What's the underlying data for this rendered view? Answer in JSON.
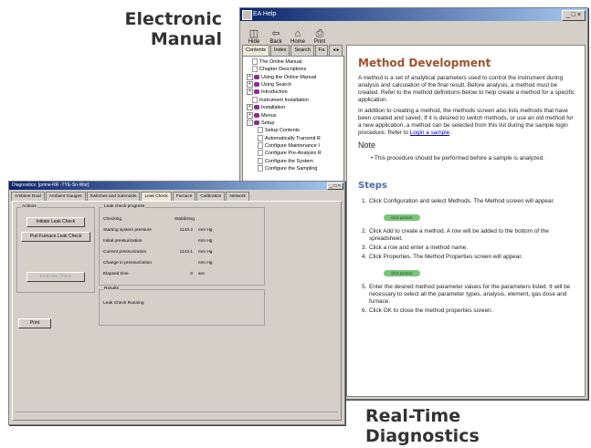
{
  "captions": {
    "manual_line1": "Electronic",
    "manual_line2": "Manual",
    "diag_line1": "Real-Time",
    "diag_line2": "Diagnostics"
  },
  "manual": {
    "title": "EA Help",
    "window_controls": "_ □ ×",
    "toolbar": [
      {
        "label": "Hide",
        "icon": "hide-icon",
        "glyph": "◫"
      },
      {
        "label": "Back",
        "icon": "back-icon",
        "glyph": "⇦"
      },
      {
        "label": "Home",
        "icon": "home-icon",
        "glyph": "⌂"
      },
      {
        "label": "Print",
        "icon": "print-icon",
        "glyph": "⎙"
      }
    ],
    "tabs": [
      "Contents",
      "Index",
      "Search",
      "Fa",
      "◂ ▸"
    ],
    "tree": [
      {
        "label": "The Online Manual",
        "type": "page",
        "indent": 1,
        "expander": ""
      },
      {
        "label": "Chapter Descriptions",
        "type": "page",
        "indent": 1,
        "expander": ""
      },
      {
        "label": "Using the Online Manual",
        "type": "book",
        "indent": 0,
        "expander": "+"
      },
      {
        "label": "Using Search",
        "type": "book",
        "indent": 0,
        "expander": "+"
      },
      {
        "label": "Introduction",
        "type": "book",
        "indent": 0,
        "expander": "+"
      },
      {
        "label": "Instrument Installation",
        "type": "page",
        "indent": 1,
        "expander": ""
      },
      {
        "label": "Installation",
        "type": "book",
        "indent": 0,
        "expander": "+"
      },
      {
        "label": "Menus",
        "type": "book",
        "indent": 0,
        "expander": "+"
      },
      {
        "label": "Setup",
        "type": "book",
        "indent": 0,
        "expander": "-"
      },
      {
        "label": "Setup Contents",
        "type": "page",
        "indent": 2,
        "expander": ""
      },
      {
        "label": "Automatically Transmit R",
        "type": "page",
        "indent": 2,
        "expander": ""
      },
      {
        "label": "Configure Maintenance I",
        "type": "page",
        "indent": 2,
        "expander": ""
      },
      {
        "label": "Configure Pre-Analysis R",
        "type": "page",
        "indent": 2,
        "expander": ""
      },
      {
        "label": "Configure the System",
        "type": "page",
        "indent": 2,
        "expander": ""
      },
      {
        "label": "Configure the Sampling",
        "type": "page",
        "indent": 2,
        "expander": ""
      }
    ],
    "doc": {
      "title": "Method Development",
      "para1": "A method is a set of analytical parameters used to control the instrument during analysis and calculation of the final result. Before analysis, a method must be created. Refer to the method definitions below to help create a method for a specific application.",
      "para2_pre": "In addition to creating a method, the methods screen also lists methods that have been created and saved. If it is desired to switch methods, or use an old method for a new application, a method can be selected from this list during the sample login procedure. Refer to",
      "para2_link": "Login a sample",
      "para2_post": ".",
      "note": "Note",
      "bullet": "This procedure should be performed before a sample is analyzed.",
      "steps_heading": "Steps",
      "step1_num": "1.",
      "step1": "Click Configuration and select Methods. The Method screen will appear.",
      "pill": "click picture",
      "step2_num": "2.",
      "step2": "Click Add to create a method. A row will be added to the bottom of the spreadsheet.",
      "step3_num": "3.",
      "step3": "Click a row and enter a method name.",
      "step4_num": "4.",
      "step4": "Click Properties. The Method Properties screen will appear.",
      "step5_num": "5.",
      "step5": "Enter the desired method parameter values for the parameters listed. It will be necessary to select all the parameter types, analysis, element, gas dose and furnace.",
      "step6_num": "6.",
      "step6": "Click OK to close the method properties screen."
    }
  },
  "diag": {
    "title": "Diagnostics: [prime-RR -TYE-Sn-Wor]",
    "window_controls": "_ □ ×",
    "tabs": [
      "Ambient Dual",
      "Ambient Gauges",
      "Switches and Solenoids",
      "Leak Check",
      "Furnace",
      "Calibration",
      "Network"
    ],
    "active_tab": 3,
    "actions_label": "Actions",
    "btn_initiate": "Initiate Leak Check",
    "btn_furnace": "Purl Furnace Leak Check",
    "btn_evaluate": "Evaluate Check",
    "btn_print": "Print",
    "progress_label": "Leak check progress",
    "progress_rows": [
      {
        "label": "Checking",
        "value": "Stabilizing",
        "unit": ""
      },
      {
        "label": "Starting system pressure",
        "value": "1143.2",
        "unit": "mm Hg"
      },
      {
        "label": "Initial pressurization",
        "value": "",
        "unit": "mm Hg"
      },
      {
        "label": "Current pressurization",
        "value": "1143.1",
        "unit": "mm Hg"
      },
      {
        "label": "Change in pressurization",
        "value": "",
        "unit": "mm Hg"
      },
      {
        "label": "Elapsed time",
        "value": "0",
        "unit": "sec"
      }
    ],
    "results_label": "Results",
    "results_text": "Leak Check Running"
  }
}
